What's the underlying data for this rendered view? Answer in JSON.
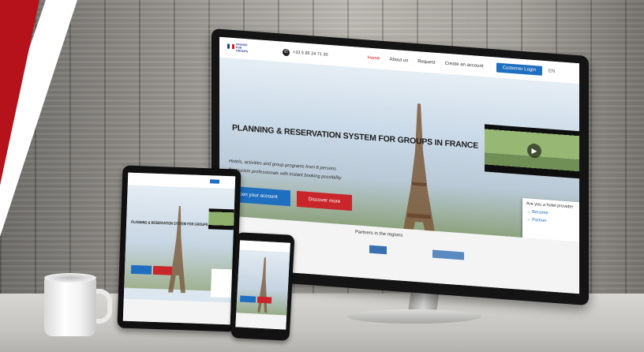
{
  "site": {
    "logo_text": "FRANCE FOR GROUPS",
    "phone": "+33 5 85 24 71 30",
    "nav": {
      "home": "Home",
      "about": "About us",
      "request": "Request",
      "create_account": "Create an account",
      "customer_login": "Customer Login",
      "language": "EN"
    },
    "hero": {
      "title": "PLANNING & RESERVATION SYSTEM FOR GROUPS IN FRANCE",
      "subtitle_line1": "Hotels, activities and group programs from 8 persons",
      "subtitle_line2": "for tourism professionals with instant booking possibility",
      "btn_account": "Open your account",
      "btn_discover": "Discover more"
    },
    "side_card": {
      "intro": "Are you a hotel provider",
      "link1": "→ Become",
      "link2": "→ Partner"
    },
    "partners_title": "Partners in the regions"
  },
  "tablet": {
    "title": "PLANNING & RESERVATION SYSTEM FOR GROUPS IN FRANCE"
  },
  "colors": {
    "brand_blue": "#1f6fc0",
    "brand_red": "#c8262a",
    "accent_red_band": "#b5121b"
  }
}
